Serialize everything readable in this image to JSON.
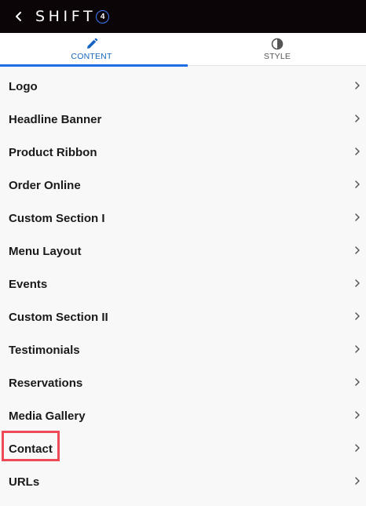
{
  "header": {
    "brand_text": "SHIFT",
    "brand_badge": "4",
    "back_icon": "chevron-left-icon"
  },
  "tabs": [
    {
      "label": "CONTENT",
      "icon": "pencil-icon",
      "active": true
    },
    {
      "label": "STYLE",
      "icon": "contrast-icon",
      "active": false
    }
  ],
  "menu": {
    "items": [
      {
        "label": "Logo"
      },
      {
        "label": "Headline Banner"
      },
      {
        "label": "Product Ribbon"
      },
      {
        "label": "Order Online"
      },
      {
        "label": "Custom Section I"
      },
      {
        "label": "Menu Layout"
      },
      {
        "label": "Events"
      },
      {
        "label": "Custom Section II"
      },
      {
        "label": "Testimonials"
      },
      {
        "label": "Reservations"
      },
      {
        "label": "Media Gallery"
      },
      {
        "label": "Contact",
        "highlighted": true
      },
      {
        "label": "URLs"
      }
    ]
  },
  "colors": {
    "topbar": "#0c0507",
    "accent": "#1e6ee8",
    "highlight": "#ee4a55",
    "background": "#f8f8f8"
  }
}
